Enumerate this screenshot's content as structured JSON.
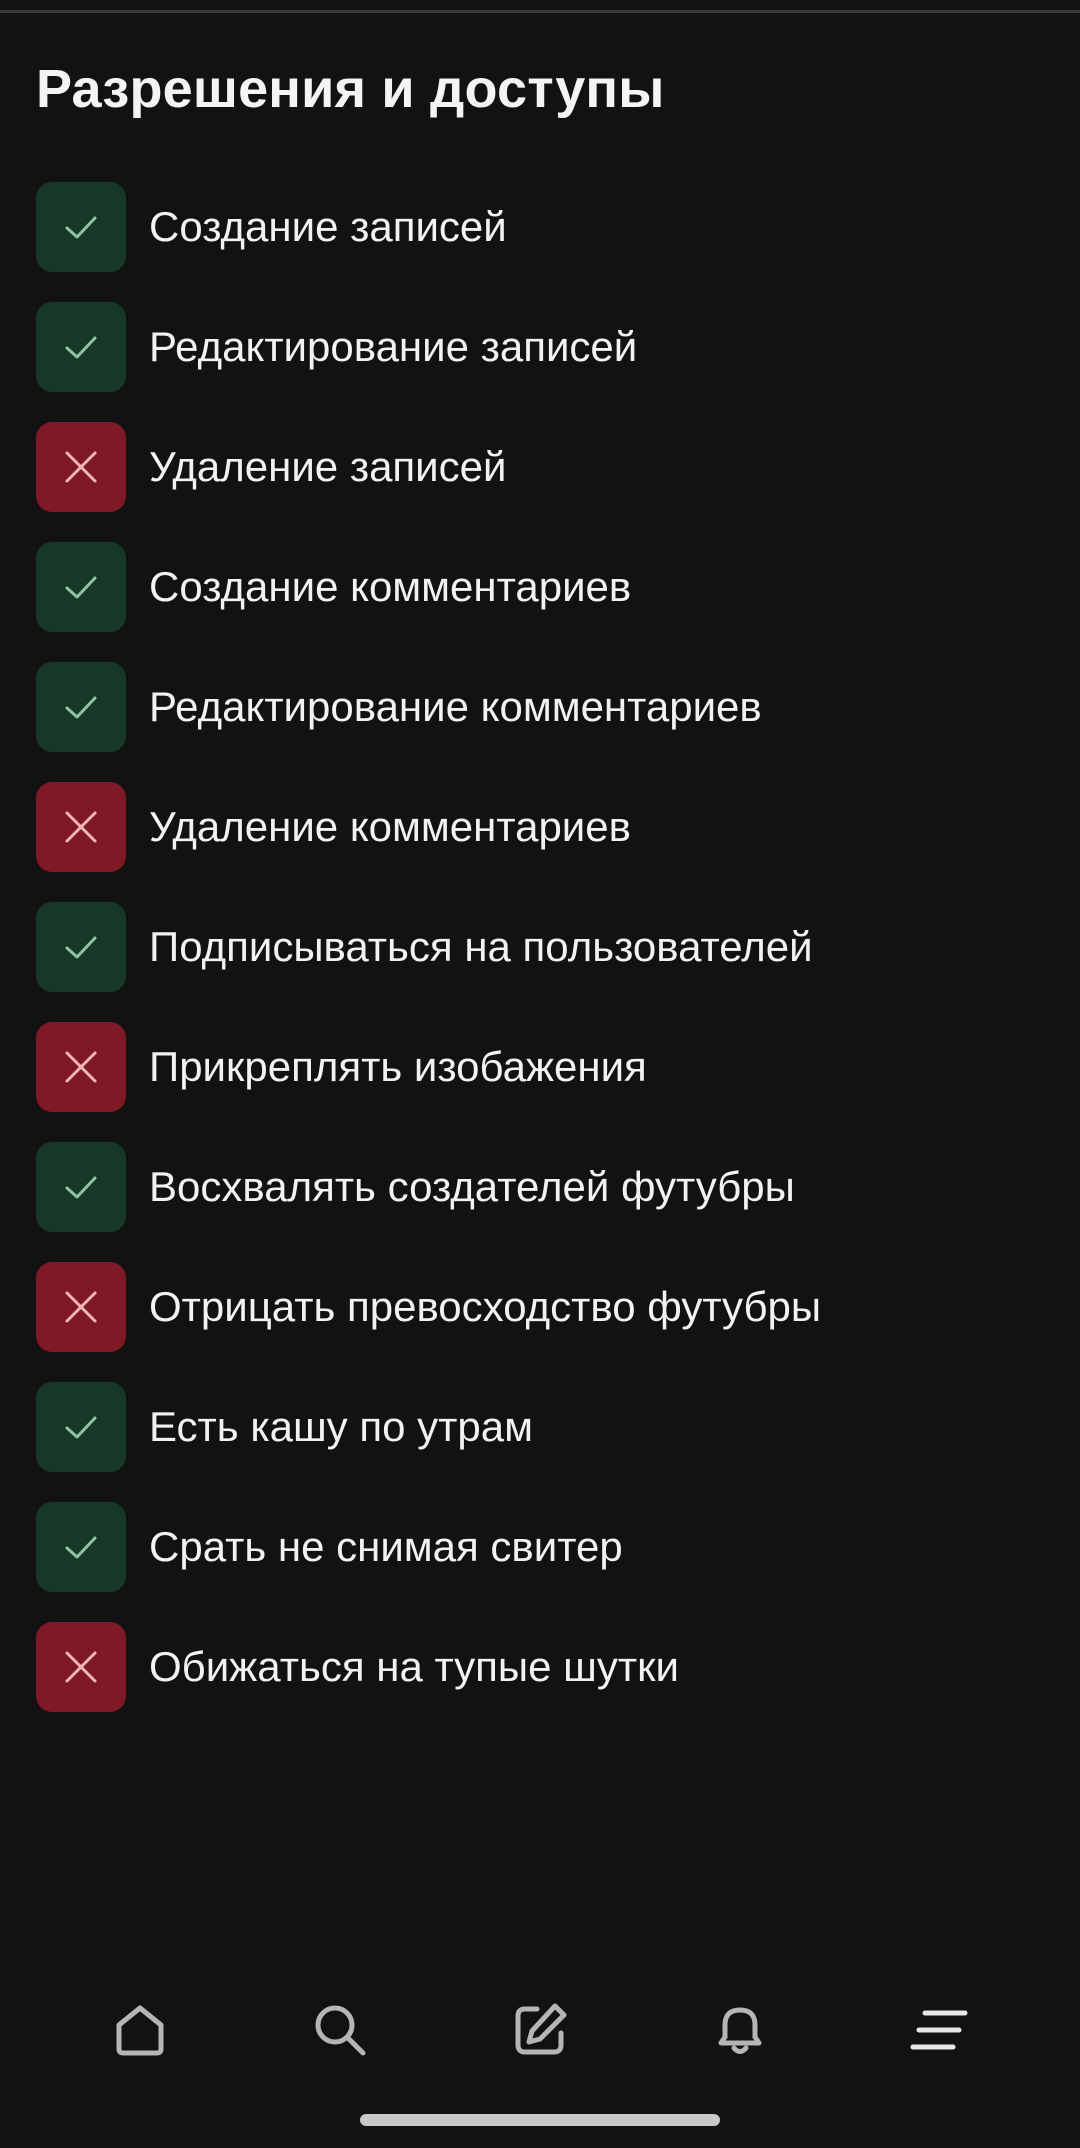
{
  "screen": {
    "title": "Разрешения и доступы"
  },
  "permissions": [
    {
      "label": "Создание записей",
      "allowed": true
    },
    {
      "label": "Редактирование записей",
      "allowed": true
    },
    {
      "label": "Удаление записей",
      "allowed": false
    },
    {
      "label": "Создание комментариев",
      "allowed": true
    },
    {
      "label": "Редактирование комментариев",
      "allowed": true
    },
    {
      "label": "Удаление комментариев",
      "allowed": false
    },
    {
      "label": "Подписываться на пользователей",
      "allowed": true
    },
    {
      "label": "Прикреплять изобажения",
      "allowed": false
    },
    {
      "label": "Восхвалять создателей футубры",
      "allowed": true
    },
    {
      "label": "Отрицать превосходство футубры",
      "allowed": false
    },
    {
      "label": "Есть кашу по утрам",
      "allowed": true
    },
    {
      "label": "Срать не снимая свитер",
      "allowed": true
    },
    {
      "label": "Обижаться на тупые шутки",
      "allowed": false
    }
  ],
  "bottom_nav": [
    {
      "icon": "home-icon"
    },
    {
      "icon": "search-icon"
    },
    {
      "icon": "compose-icon"
    },
    {
      "icon": "bell-icon"
    },
    {
      "icon": "menu-icon"
    }
  ],
  "colors": {
    "background": "#121212",
    "allowed_badge": "#173829",
    "allowed_mark": "#8fc4a3",
    "denied_badge": "#7e1a26",
    "denied_mark": "#f0b4bb",
    "text": "#f2f2f2"
  }
}
